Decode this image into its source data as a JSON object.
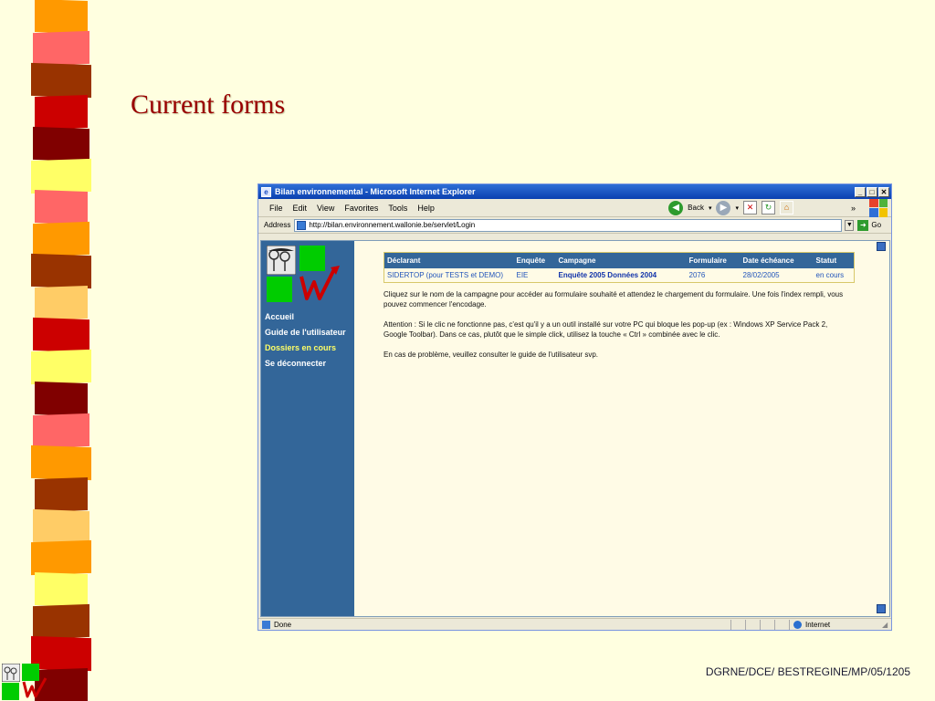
{
  "slide": {
    "title": "Current forms",
    "footer": "DGRNE/DCE/ BESTREGINE/MP/05/1205"
  },
  "colors": {
    "stripes": [
      "#ff9900",
      "#ff6666",
      "#993300",
      "#cc0000",
      "#800000",
      "#ffff66",
      "#ff6666",
      "#ff9900",
      "#993300",
      "#ffcc66",
      "#cc0000",
      "#ffff66",
      "#800000",
      "#ff6666",
      "#ff9900",
      "#993300",
      "#ffcc66",
      "#ff9900",
      "#ffff66",
      "#993300",
      "#cc0000",
      "#800000"
    ],
    "sidebar": "#336699",
    "accent": "#990000"
  },
  "browser": {
    "title": "Bilan environnemental - Microsoft Internet Explorer",
    "menu": [
      "File",
      "Edit",
      "View",
      "Favorites",
      "Tools",
      "Help"
    ],
    "back_label": "Back",
    "address_label": "Address",
    "address_url": "http://bilan.environnement.wallonie.be/servlet/Login",
    "go_label": "Go",
    "status_left": "Done",
    "status_zone": "Internet"
  },
  "sidebar": {
    "nav": [
      {
        "label": "Accueil"
      },
      {
        "label": "Guide de l'utilisateur"
      },
      {
        "label": "Dossiers en cours"
      },
      {
        "label": "Se déconnecter"
      }
    ]
  },
  "table": {
    "headers": [
      "Déclarant",
      "Enquête",
      "Campagne",
      "Formulaire",
      "Date échéance",
      "Statut"
    ],
    "row": [
      "SIDERTOP (pour TESTS et DEMO)",
      "EIE",
      "Enquête 2005 Données 2004",
      "2076",
      "28/02/2005",
      "en cours"
    ]
  },
  "help": {
    "p1": "Cliquez sur le nom de la campagne pour accéder au formulaire souhaité et attendez le chargement du formulaire. Une fois l'index rempli, vous pouvez commencer l'encodage.",
    "p2": "Attention : Si le clic ne fonctionne pas, c'est qu'il y a un outil installé sur votre PC qui bloque les pop-up (ex : Windows XP Service Pack 2, Google Toolbar). Dans ce cas, plutôt que le simple click, utilisez la touche « Ctrl » combinée avec le clic.",
    "p3": "En cas de problème, veuillez consulter le guide de l'utilisateur svp."
  }
}
